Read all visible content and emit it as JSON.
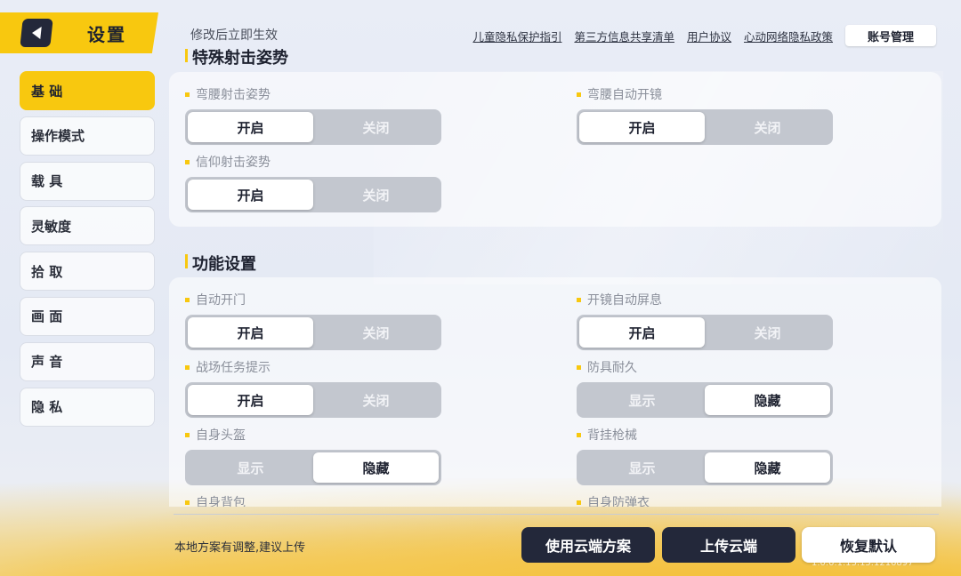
{
  "header": {
    "title": "设置",
    "notice": "修改后立即生效",
    "links": [
      "儿童隐私保护指引",
      "第三方信息共享清单",
      "用户协议",
      "心动网络隐私政策"
    ],
    "account_button": "账号管理"
  },
  "sidebar": {
    "items": [
      {
        "label": "基 础"
      },
      {
        "label": "操作模式"
      },
      {
        "label": "载 具"
      },
      {
        "label": "灵敏度"
      },
      {
        "label": "拾 取"
      },
      {
        "label": "画 面"
      },
      {
        "label": "声 音"
      },
      {
        "label": "隐 私"
      }
    ],
    "active_index": 0
  },
  "sections": {
    "special_shooting": {
      "title": "特殊射击姿势",
      "settings": [
        {
          "label": "弯腰射击姿势",
          "options": [
            "开启",
            "关闭"
          ],
          "selected": "开启"
        },
        {
          "label": "弯腰自动开镜",
          "options": [
            "开启",
            "关闭"
          ],
          "selected": "开启"
        },
        {
          "label": "信仰射击姿势",
          "options": [
            "开启",
            "关闭"
          ],
          "selected": "开启"
        }
      ]
    },
    "functions": {
      "title": "功能设置",
      "settings": [
        {
          "label": "自动开门",
          "options": [
            "开启",
            "关闭"
          ],
          "selected": "开启"
        },
        {
          "label": "开镜自动屏息",
          "options": [
            "开启",
            "关闭"
          ],
          "selected": "开启"
        },
        {
          "label": "战场任务提示",
          "options": [
            "开启",
            "关闭"
          ],
          "selected": "开启"
        },
        {
          "label": "防具耐久",
          "options": [
            "显示",
            "隐藏"
          ],
          "selected": "隐藏"
        },
        {
          "label": "自身头盔",
          "options": [
            "显示",
            "隐藏"
          ],
          "selected": "隐藏"
        },
        {
          "label": "背挂枪械",
          "options": [
            "显示",
            "隐藏"
          ],
          "selected": "隐藏"
        },
        {
          "label": "自身背包"
        },
        {
          "label": "自身防弹衣"
        }
      ]
    }
  },
  "footer": {
    "note": "本地方案有调整,建议上传",
    "use_cloud": "使用云端方案",
    "upload_cloud": "上传云端",
    "restore_default": "恢复默认",
    "version": "1.0.0.1.13.15.1216897"
  },
  "colors": {
    "accent": "#f8c80f",
    "dark_button": "#23283a",
    "toggle_track": "#c3c7cf"
  }
}
